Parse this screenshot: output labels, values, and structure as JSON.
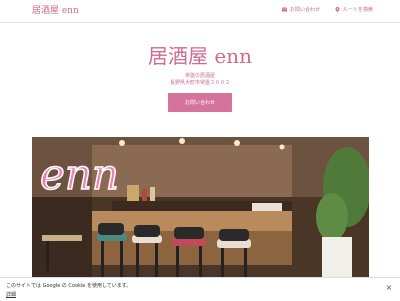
{
  "header": {
    "brand": "居酒屋 enn",
    "nav": {
      "contact_label": "お問い合わせ",
      "contact_icon": "mail-icon",
      "route_label": "ルートを検索",
      "route_icon": "location-pin-icon"
    }
  },
  "hero": {
    "title": "居酒屋 enn",
    "tagline": "常盤の居酒屋",
    "address": "長野県大町市常盤３６０２",
    "cta_label": "お問い合わせ",
    "image_logo_text": "enn"
  },
  "cookie_notice": {
    "text": "このサイトでは Google の Cookie を使用しています。",
    "details_label": "詳細",
    "close_icon": "close-icon"
  },
  "colors": {
    "accent": "#d06a8e",
    "button": "#d6739a"
  }
}
